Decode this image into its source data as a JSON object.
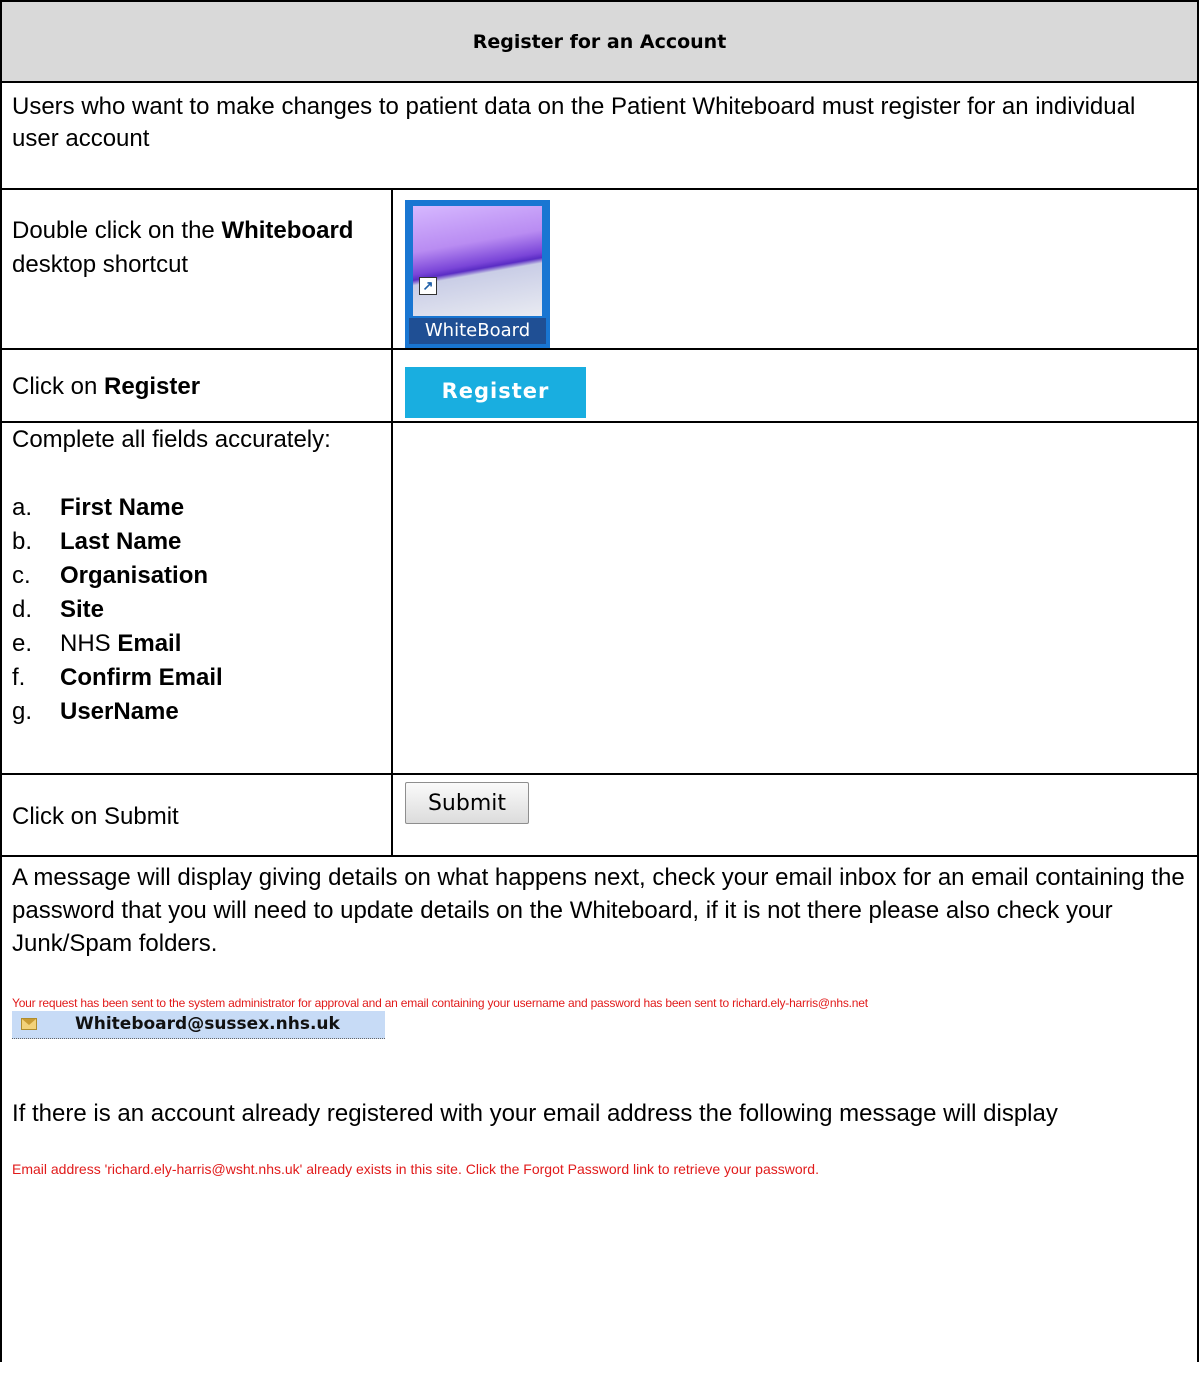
{
  "header": {
    "title": "Register for an Account"
  },
  "intro": "Users who want to make changes to patient data on the Patient Whiteboard must register for an individual user account",
  "step1": {
    "pre": "Double click on the ",
    "bold": "Whiteboard",
    "post": " desktop shortcut",
    "icon_label": "WhiteBoard"
  },
  "step2": {
    "pre": "Click on ",
    "bold": "Register",
    "button": "Register"
  },
  "step3": {
    "intro": "Complete all fields accurately:",
    "fields": [
      {
        "letter": "a.",
        "pre": "",
        "bold": "First Name"
      },
      {
        "letter": "b.",
        "pre": "",
        "bold": "Last Name"
      },
      {
        "letter": "c.",
        "pre": "",
        "bold": "Organisation"
      },
      {
        "letter": "d.",
        "pre": "",
        "bold": "Site"
      },
      {
        "letter": "e.",
        "pre": "NHS ",
        "bold": "Email"
      },
      {
        "letter": "f.",
        "pre": "",
        "bold": "Confirm Email"
      },
      {
        "letter": "g.",
        "pre": "",
        "bold": "UserName"
      }
    ]
  },
  "step4": {
    "text": "Click on Submit",
    "button": "Submit"
  },
  "final": {
    "paragraph": "A message will display giving details on what happens next, check your email inbox for an email containing the password that you will need to update details on the Whiteboard, if it is not there please also check your Junk/Spam folders.",
    "sent_message": "Your request has been sent to the system administrator for approval and an email containing your username and password has been sent to richard.ely-harris@nhs.net",
    "sender": "Whiteboard@sussex.nhs.uk",
    "existing_paragraph": "If there is an account already registered with your email address the following message will display",
    "exists_message": "Email address 'richard.ely-harris@wsht.nhs.uk' already exists in this site. Click the Forgot Password link to retrieve your password."
  }
}
